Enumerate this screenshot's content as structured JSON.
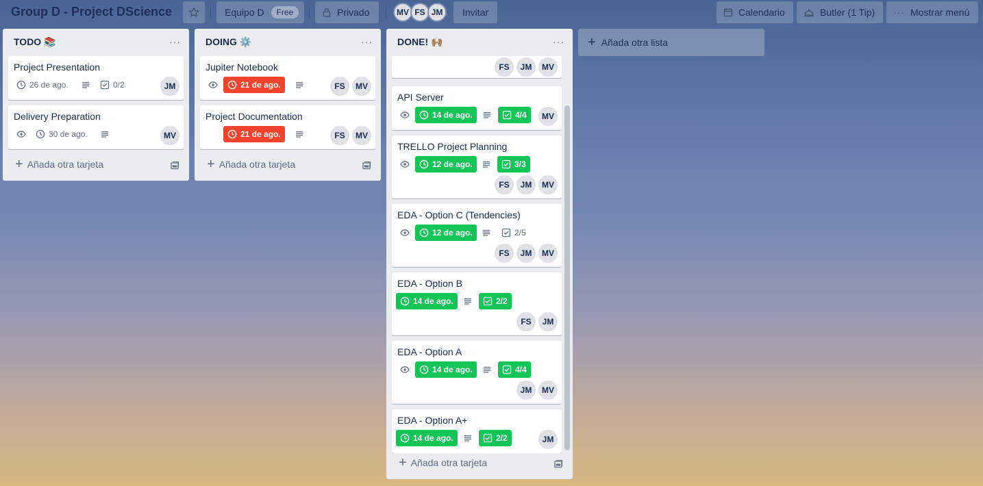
{
  "board": {
    "title": "Group D - Project DScience",
    "team": "Equipo D",
    "team_badge": "Free",
    "visibility": "Privado",
    "invite": "Invitar",
    "members": [
      "MV",
      "FS",
      "JM"
    ],
    "calendar": "Calendario",
    "butler": "Butler (1 Tip)",
    "menu": "Mostrar menú"
  },
  "lists": [
    {
      "title": "TODO 📚",
      "add_card": "Añada otra tarjeta",
      "cards": [
        {
          "title": "Project Presentation",
          "due": "26 de ago.",
          "checklist": "0/2",
          "members": [
            "JM"
          ]
        },
        {
          "title": "Delivery Preparation",
          "due": "30 de ago.",
          "members": [
            "MV"
          ]
        }
      ]
    },
    {
      "title": "DOING ⚙️",
      "add_card": "Añada otra tarjeta",
      "cards": [
        {
          "title": "Jupiter Notebook",
          "due": "21 de ago.",
          "members": [
            "FS",
            "MV"
          ]
        },
        {
          "title": "Project Documentation",
          "due": "21 de ago.",
          "members": [
            "FS",
            "MV"
          ]
        }
      ]
    },
    {
      "title": "DONE! 🙌🏽",
      "add_card": "Añada otra tarjeta",
      "cards": [
        {
          "title": "",
          "members": [
            "FS",
            "JM",
            "MV"
          ]
        },
        {
          "title": "API Server",
          "due": "14 de ago.",
          "checklist": "4/4",
          "members": [
            "MV"
          ]
        },
        {
          "title": "TRELLO Project Planning",
          "due": "12 de ago.",
          "checklist": "3/3",
          "members": [
            "FS",
            "JM",
            "MV"
          ]
        },
        {
          "title": "EDA - Option C (Tendencies)",
          "due": "12 de ago.",
          "checklist": "2/5",
          "members": [
            "FS",
            "JM",
            "MV"
          ]
        },
        {
          "title": "EDA - Option B",
          "due": "14 de ago.",
          "checklist": "2/2",
          "members": [
            "FS",
            "JM"
          ]
        },
        {
          "title": "EDA - Option A",
          "due": "14 de ago.",
          "checklist": "4/4",
          "members": [
            "JM",
            "MV"
          ]
        },
        {
          "title": "EDA - Option A+",
          "due": "14 de ago.",
          "checklist": "2/2",
          "members": [
            "JM"
          ]
        }
      ]
    }
  ],
  "add_list": "Añada otra lista",
  "colors": {
    "due_overdue": "#f0432c",
    "complete": "#13c557",
    "list_bg": "#ebecf0"
  }
}
